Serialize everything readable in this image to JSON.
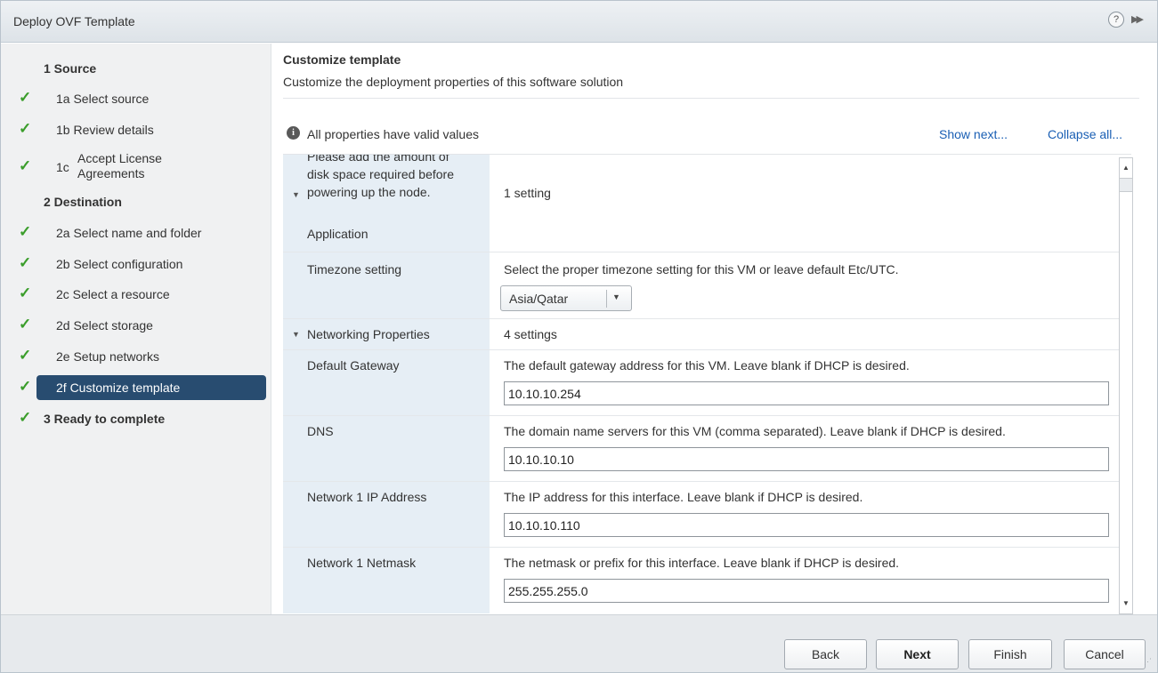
{
  "window": {
    "title": "Deploy OVF Template",
    "help_icon": "?",
    "expand_icon": "»"
  },
  "sidebar": {
    "steps": [
      {
        "label": "1 Source"
      },
      {
        "label": "1a Select source"
      },
      {
        "label": "1b Review details"
      },
      {
        "num": "1c",
        "label_line1": "Accept License",
        "label_line2": "Agreements"
      },
      {
        "label": "2 Destination"
      },
      {
        "label": "2a Select name and folder"
      },
      {
        "label": "2b Select configuration"
      },
      {
        "label": "2c Select a resource"
      },
      {
        "label": "2d Select storage"
      },
      {
        "label": "2e Setup networks"
      },
      {
        "label": "2f Customize template"
      },
      {
        "label": "3 Ready to complete"
      }
    ],
    "check_glyph": "✓"
  },
  "main": {
    "heading": "Customize template",
    "description": "Customize the deployment properties of this software solution",
    "status": "All properties have valid values",
    "show_next": "Show next...",
    "collapse_all": "Collapse all...",
    "info_glyph": "i"
  },
  "properties": {
    "disk_group": {
      "label_line0": "Please add the amount of",
      "label_line1": "disk space required before",
      "label_line2": "powering up the node.",
      "count": "1 setting"
    },
    "application_label": "Application",
    "timezone": {
      "label": "Timezone setting",
      "description": "Select the proper timezone setting for this VM or leave default Etc/UTC.",
      "value": "Asia/Qatar"
    },
    "networking_group": {
      "label": "Networking Properties",
      "count": "4 settings"
    },
    "gateway": {
      "label": "Default Gateway",
      "description": "The default gateway address for this VM. Leave blank if DHCP is desired.",
      "value": "10.10.10.254"
    },
    "dns": {
      "label": "DNS",
      "description": "The domain name servers for this VM (comma separated). Leave blank if DHCP is desired.",
      "value": "10.10.10.10"
    },
    "ip": {
      "label": "Network 1 IP Address",
      "description": "The IP address for this interface. Leave blank if DHCP is desired.",
      "value": "10.10.10.110"
    },
    "netmask": {
      "label": "Network 1 Netmask",
      "description": "The netmask or prefix for this interface. Leave blank if DHCP is desired.",
      "value": "255.255.255.0"
    }
  },
  "footer": {
    "back": "Back",
    "next": "Next",
    "finish": "Finish",
    "cancel": "Cancel"
  }
}
